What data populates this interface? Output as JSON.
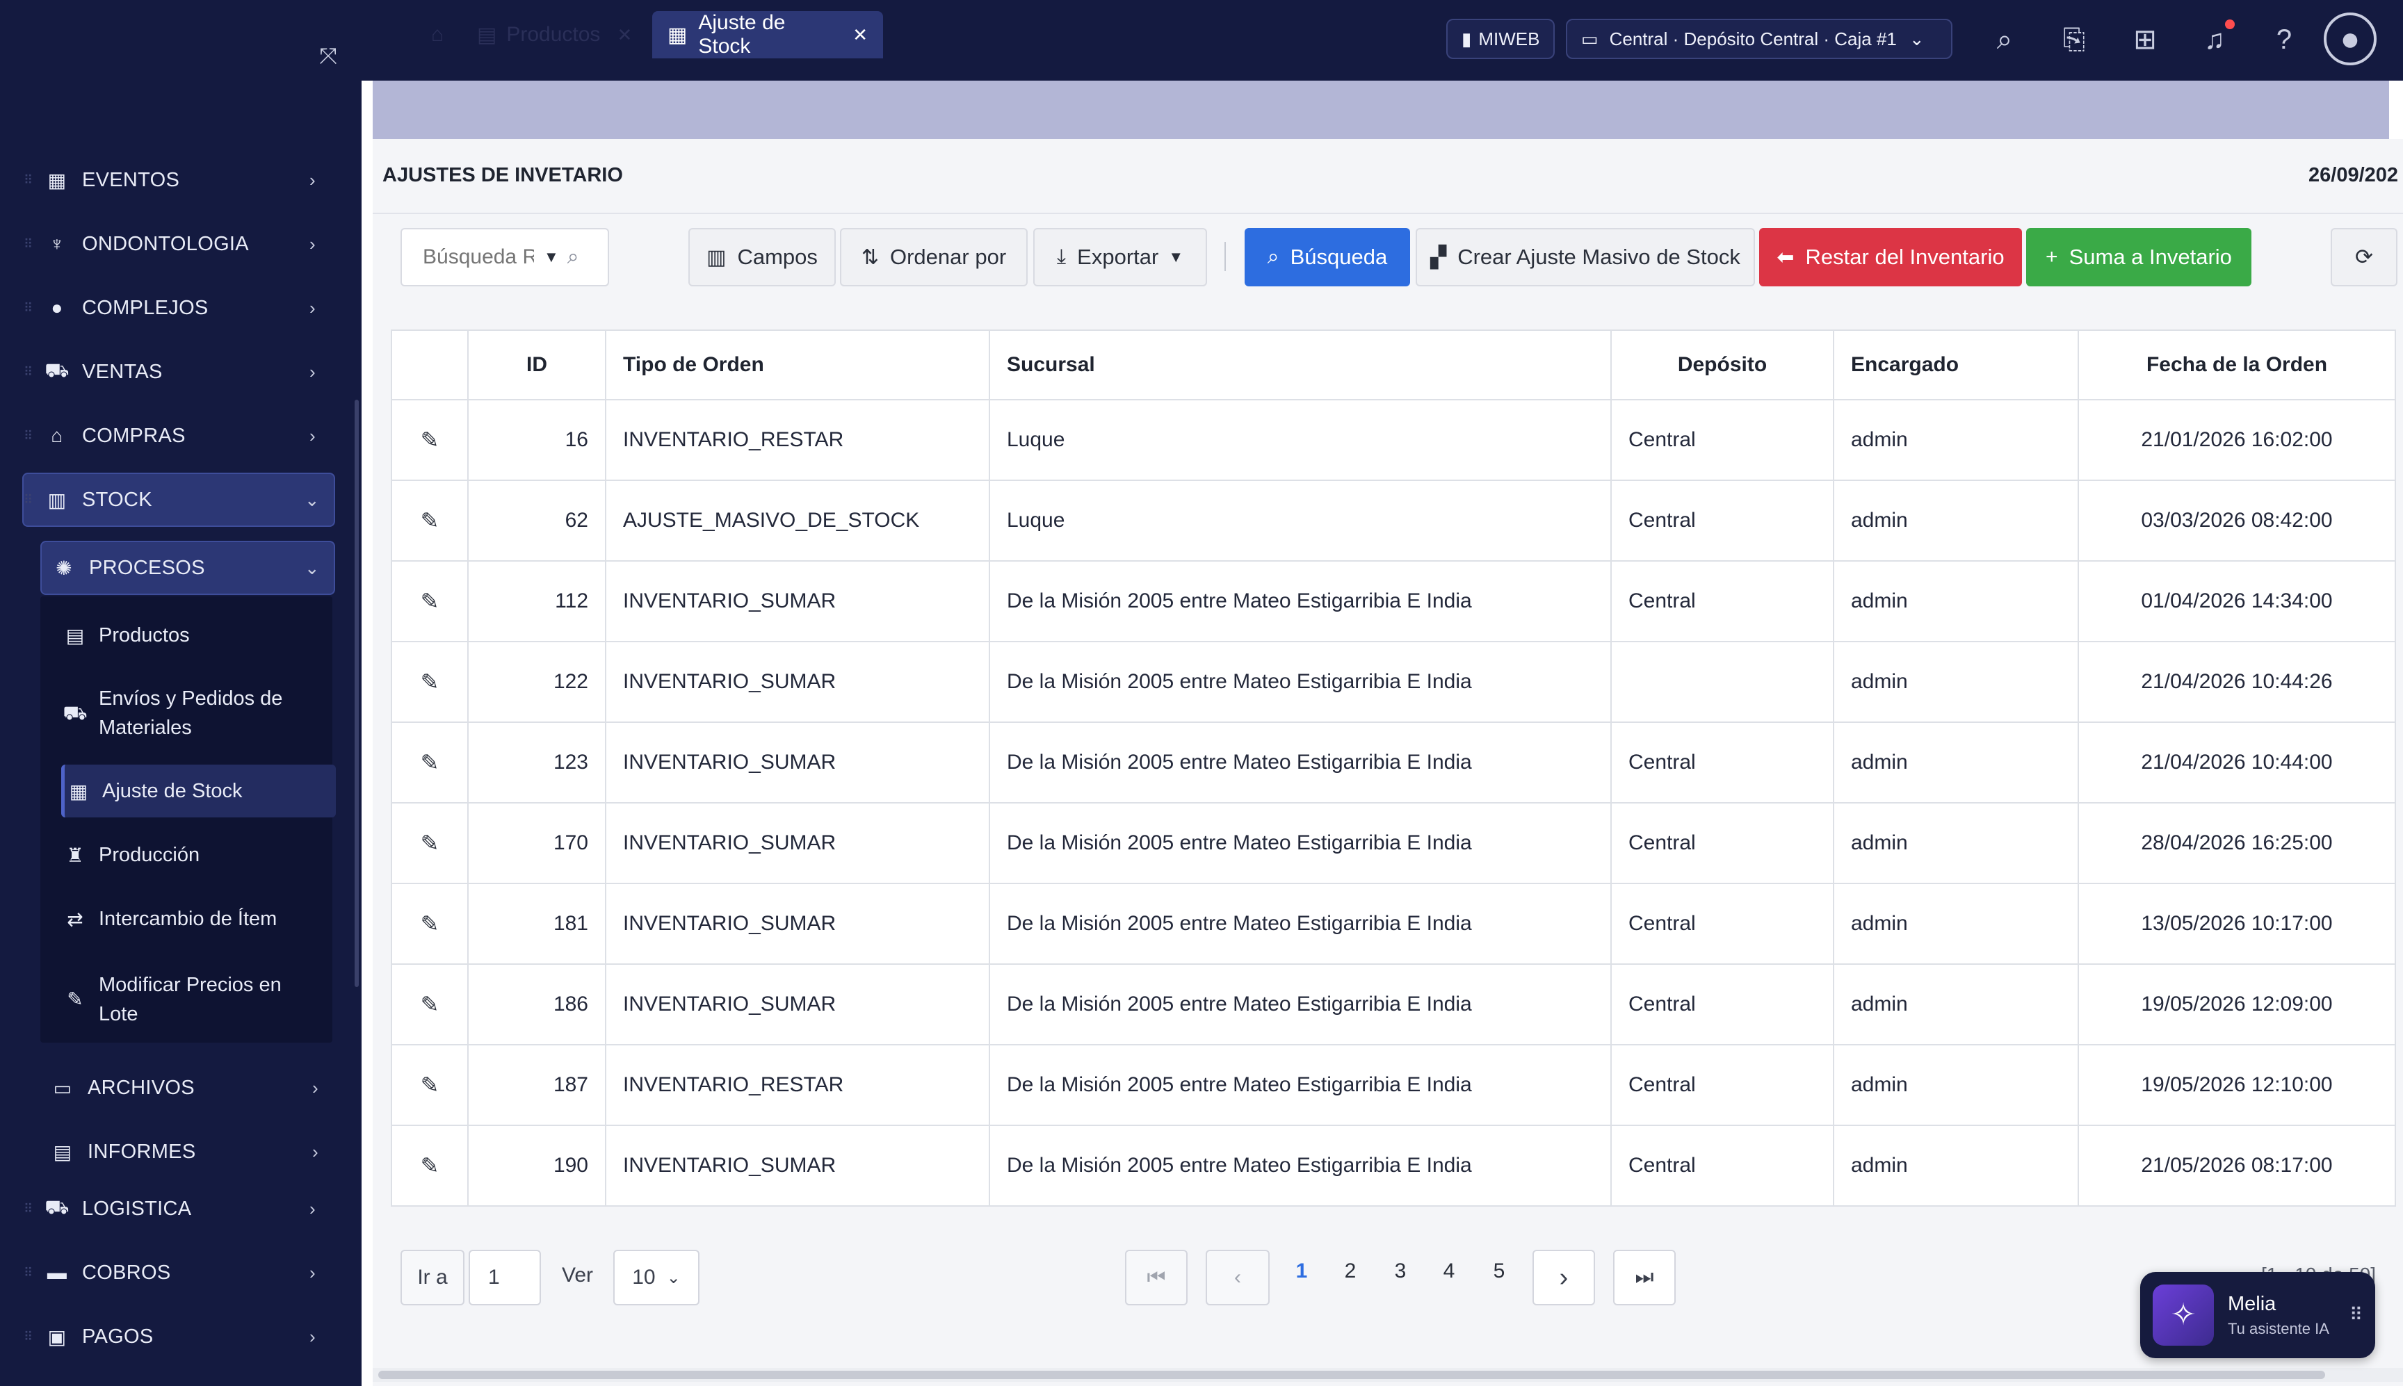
{
  "topbar": {
    "company_badge": "MIWEB",
    "location_selector": "Central · Depósito Central · Caja #1"
  },
  "sidebar": {
    "items": [
      {
        "label": "EVENTOS",
        "icon": "calendar-icon"
      },
      {
        "label": "ONDONTOLOGIA",
        "icon": "tooth-icon"
      },
      {
        "label": "COMPLEJOS",
        "icon": "users-icon"
      },
      {
        "label": "VENTAS",
        "icon": "cart-icon"
      },
      {
        "label": "COMPRAS",
        "icon": "basket-icon"
      },
      {
        "label": "STOCK",
        "icon": "barcode-icon"
      },
      {
        "label": "PROCESOS",
        "icon": "gear-icon"
      },
      {
        "label": "ARCHIVOS",
        "icon": "folder-icon"
      },
      {
        "label": "INFORMES",
        "icon": "report-icon"
      },
      {
        "label": "LOGISTICA",
        "icon": "truck-icon"
      },
      {
        "label": "COBROS",
        "icon": "card-icon"
      },
      {
        "label": "PAGOS",
        "icon": "money-icon"
      }
    ],
    "sub_items": [
      {
        "label": "Productos",
        "icon": "products-icon"
      },
      {
        "label": "Envíos y Pedidos de Materiales",
        "icon": "shipping-icon"
      },
      {
        "label": "Ajuste de Stock",
        "icon": "table-icon"
      },
      {
        "label": "Producción",
        "icon": "production-icon"
      },
      {
        "label": "Intercambio de Ítem",
        "icon": "swap-icon"
      },
      {
        "label": "Modificar Precios en Lote",
        "icon": "edit-icon"
      }
    ]
  },
  "tabs": [
    {
      "label": "Productos"
    },
    {
      "label": "Ajuste de Stock"
    }
  ],
  "page": {
    "title": "AJUSTES DE INVETARIO",
    "date": "26/09/202"
  },
  "toolbar": {
    "search_placeholder": "Búsqueda R",
    "fields_label": "Campos",
    "sort_label": "Ordenar por",
    "export_label": "Exportar",
    "search_label": "Búsqueda",
    "mass_adjust_label": "Crear Ajuste Masivo de Stock",
    "subtract_label": "Restar del Inventario",
    "add_label": "Suma a Invetario"
  },
  "table": {
    "columns": [
      "ID",
      "Tipo de Orden",
      "Sucursal",
      "Depósito",
      "Encargado",
      "Fecha de la Orden"
    ],
    "rows": [
      {
        "id": "16",
        "tipo": "INVENTARIO_RESTAR",
        "sucursal": "Luque",
        "deposito": "Central",
        "encargado": "admin",
        "fecha": "21/01/2026 16:02:00"
      },
      {
        "id": "62",
        "tipo": "AJUSTE_MASIVO_DE_STOCK",
        "sucursal": "Luque",
        "deposito": "Central",
        "encargado": "admin",
        "fecha": "03/03/2026 08:42:00"
      },
      {
        "id": "112",
        "tipo": "INVENTARIO_SUMAR",
        "sucursal": "De la Misión 2005 entre Mateo Estigarribia E India",
        "deposito": "Central",
        "encargado": "admin",
        "fecha": "01/04/2026 14:34:00"
      },
      {
        "id": "122",
        "tipo": "INVENTARIO_SUMAR",
        "sucursal": "De la Misión 2005 entre Mateo Estigarribia E India",
        "deposito": "",
        "encargado": "admin",
        "fecha": "21/04/2026 10:44:26"
      },
      {
        "id": "123",
        "tipo": "INVENTARIO_SUMAR",
        "sucursal": "De la Misión 2005 entre Mateo Estigarribia E India",
        "deposito": "Central",
        "encargado": "admin",
        "fecha": "21/04/2026 10:44:00"
      },
      {
        "id": "170",
        "tipo": "INVENTARIO_SUMAR",
        "sucursal": "De la Misión 2005 entre Mateo Estigarribia E India",
        "deposito": "Central",
        "encargado": "admin",
        "fecha": "28/04/2026 16:25:00"
      },
      {
        "id": "181",
        "tipo": "INVENTARIO_SUMAR",
        "sucursal": "De la Misión 2005 entre Mateo Estigarribia E India",
        "deposito": "Central",
        "encargado": "admin",
        "fecha": "13/05/2026 10:17:00"
      },
      {
        "id": "186",
        "tipo": "INVENTARIO_SUMAR",
        "sucursal": "De la Misión 2005 entre Mateo Estigarribia E India",
        "deposito": "Central",
        "encargado": "admin",
        "fecha": "19/05/2026 12:09:00"
      },
      {
        "id": "187",
        "tipo": "INVENTARIO_RESTAR",
        "sucursal": "De la Misión 2005 entre Mateo Estigarribia E India",
        "deposito": "Central",
        "encargado": "admin",
        "fecha": "19/05/2026 12:10:00"
      },
      {
        "id": "190",
        "tipo": "INVENTARIO_SUMAR",
        "sucursal": "De la Misión 2005 entre Mateo Estigarribia E India",
        "deposito": "Central",
        "encargado": "admin",
        "fecha": "21/05/2026 08:17:00"
      }
    ]
  },
  "pagination": {
    "goto_label": "Ir a",
    "goto_value": "1",
    "view_label": "Ver",
    "page_size": "10",
    "pages": [
      "1",
      "2",
      "3",
      "4",
      "5"
    ],
    "current_page": "1",
    "range_text": "[1 - 10 de 50]"
  },
  "assistant": {
    "name": "Melia",
    "subtitle": "Tu asistente IA"
  },
  "colors": {
    "sidebar_bg": "#141a40",
    "primary": "#2d6de0",
    "danger": "#dc3545",
    "success": "#3aaa47"
  }
}
